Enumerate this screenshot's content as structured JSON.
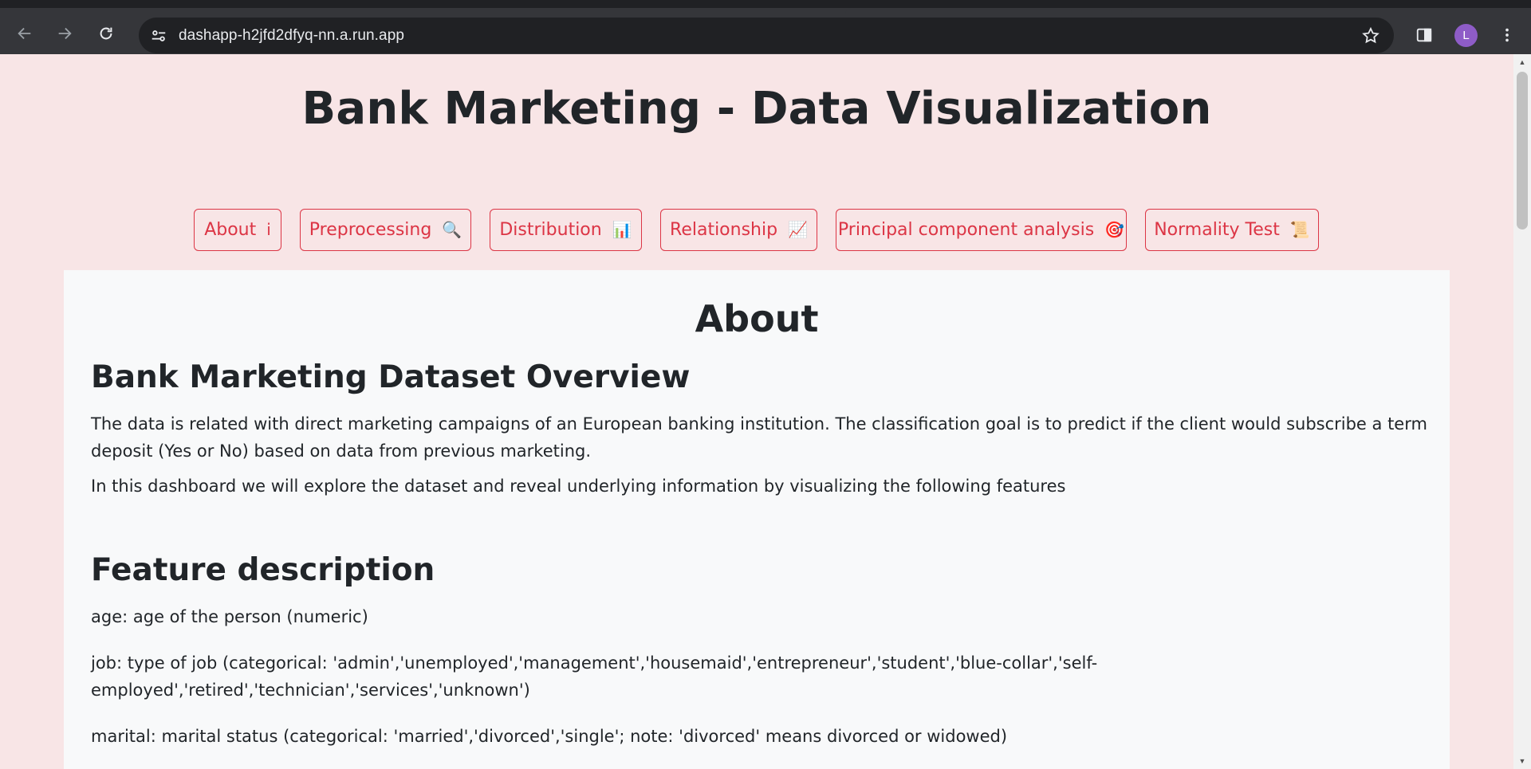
{
  "browser": {
    "url": "dashapp-h2jfd2dfyq-nn.a.run.app",
    "avatar_letter": "L"
  },
  "page": {
    "title": "Bank Marketing - Data Visualization",
    "tabs": [
      {
        "label": "About",
        "emoji": "i"
      },
      {
        "label": "Preprocessing",
        "emoji": "🔍"
      },
      {
        "label": "Distribution",
        "emoji": "📊"
      },
      {
        "label": "Relationship",
        "emoji": "📈"
      },
      {
        "label": "Principal component analysis",
        "emoji": "🎯"
      },
      {
        "label": "Normality Test",
        "emoji": "📜"
      }
    ],
    "accent_color": "#dc3545",
    "background_color": "#f8e5e6"
  },
  "content": {
    "heading": "About",
    "overview_title": "Bank Marketing Dataset Overview",
    "overview_p1": "The data is related with direct marketing campaigns of an European banking institution. The classification goal is to predict if the client would subscribe a term deposit (Yes or No) based on data from previous marketing.",
    "overview_p2": "In this dashboard we will explore the dataset and reveal underlying information by visualizing the following features",
    "features_title": "Feature description",
    "features": [
      "age: age of the person (numeric)",
      "job: type of job (categorical: 'admin','unemployed','management','housemaid','entrepreneur','student','blue-collar','self-employed','retired','technician','services','unknown')",
      "marital: marital status (categorical: 'married','divorced','single'; note: 'divorced' means divorced or widowed)"
    ]
  }
}
